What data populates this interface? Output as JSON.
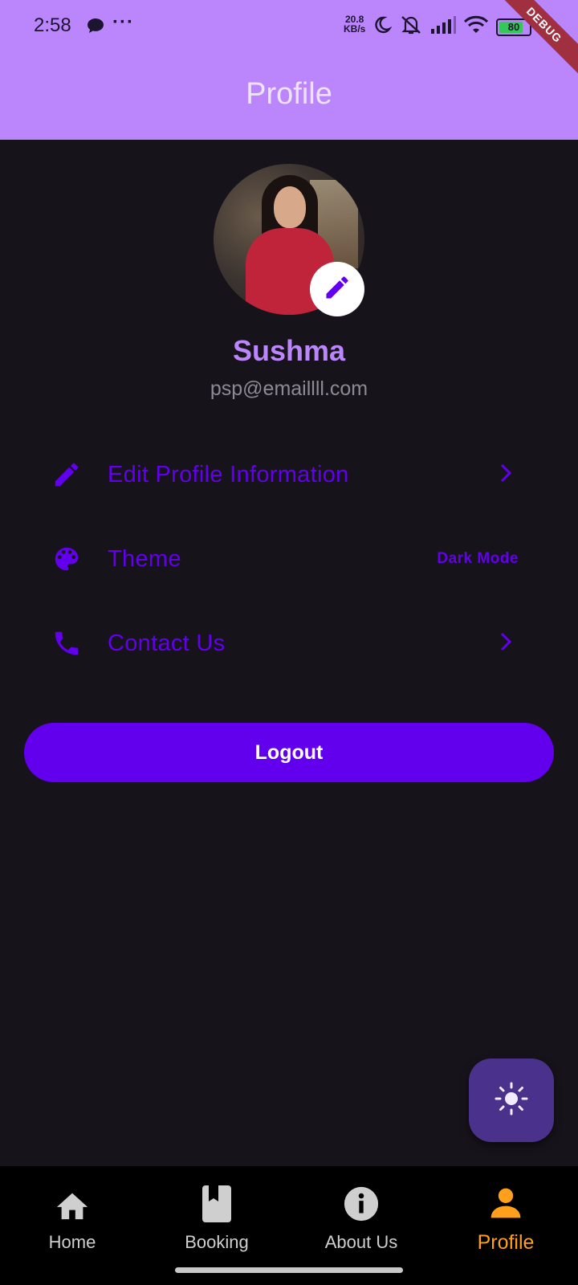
{
  "status_bar": {
    "time": "2:58",
    "dots": "···",
    "net_speed_value": "20.8",
    "net_speed_unit": "KB/s",
    "battery": "80",
    "battery_level": 0.8
  },
  "debug_banner": "DEBUG",
  "app_bar": {
    "title": "Profile"
  },
  "profile": {
    "name": "Sushma",
    "email": "psp@emaillll.com"
  },
  "menu": [
    {
      "label": "Edit Profile Information",
      "icon": "pencil-icon",
      "trailing": "chevron-right-icon"
    },
    {
      "label": "Theme",
      "icon": "palette-icon",
      "trailing_text": "Dark Mode"
    },
    {
      "label": "Contact Us",
      "icon": "phone-icon",
      "trailing": "chevron-right-icon"
    }
  ],
  "logout_label": "Logout",
  "fab_icon": "sun-icon",
  "bottom_nav": [
    {
      "label": "Home",
      "icon": "home-icon"
    },
    {
      "label": "Booking",
      "icon": "book-icon"
    },
    {
      "label": "About Us",
      "icon": "info-icon"
    },
    {
      "label": "Profile",
      "icon": "person-icon",
      "active": true
    }
  ],
  "colors": {
    "app_bar": "#bb86fc",
    "background": "#16131a",
    "primary": "#6200ee",
    "fab": "#4a318c",
    "active_nav": "#ff9f1c"
  }
}
